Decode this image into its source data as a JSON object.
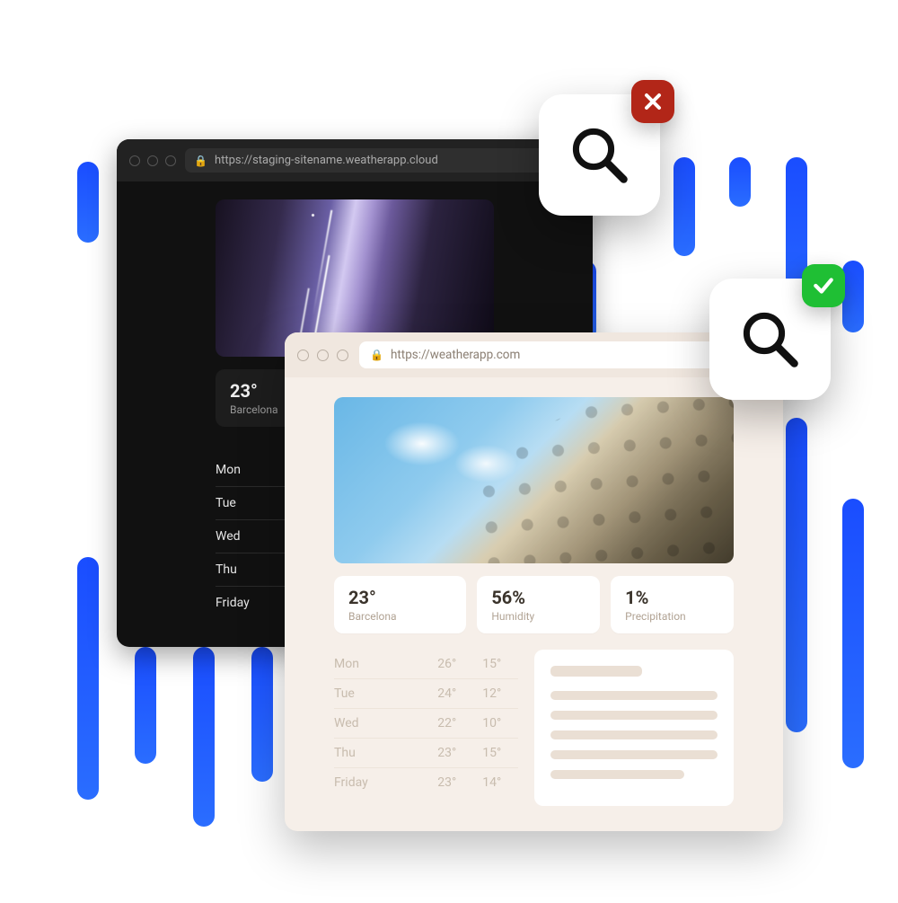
{
  "colors": {
    "blue_bar": "#1a4dff",
    "good": "#1fbf34",
    "bad": "#b22618",
    "lock": "#26c764"
  },
  "dark_window": {
    "url": "https://staging-sitename.weatherapp.cloud",
    "temperature": "23°",
    "city": "Barcelona",
    "days": [
      "Mon",
      "Tue",
      "Wed",
      "Thu",
      "Friday"
    ]
  },
  "light_window": {
    "url": "https://weatherapp.com",
    "stats": [
      {
        "value": "23°",
        "label": "Barcelona"
      },
      {
        "value": "56%",
        "label": "Humidity"
      },
      {
        "value": "1%",
        "label": "Precipitation"
      }
    ],
    "forecast": [
      {
        "day": "Mon",
        "hi": "26°",
        "lo": "15°"
      },
      {
        "day": "Tue",
        "hi": "24°",
        "lo": "12°"
      },
      {
        "day": "Wed",
        "hi": "22°",
        "lo": "10°"
      },
      {
        "day": "Thu",
        "hi": "23°",
        "lo": "15°"
      },
      {
        "day": "Friday",
        "hi": "23°",
        "lo": "14°"
      }
    ]
  },
  "badges": {
    "top_status": "x",
    "bottom_status": "check"
  }
}
